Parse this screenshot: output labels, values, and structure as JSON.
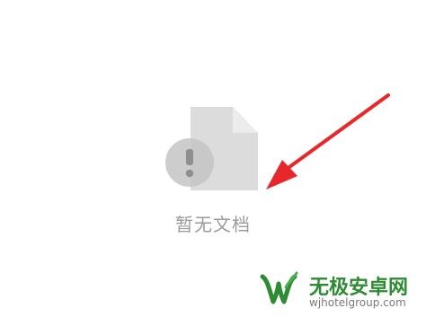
{
  "empty_state": {
    "message": "暂无文档",
    "illustration_icon": "document-warning-icon"
  },
  "annotation": {
    "icon": "red-arrow-icon",
    "color": "#e8272b"
  },
  "watermark": {
    "title": "无极安卓网",
    "url": "wjhotelgroup.com",
    "logo_icon": "w-leaf-logo-icon",
    "brand_color": "#2e8b34"
  },
  "colors": {
    "background": "#ffffff",
    "icon_gray": "#d8d8d8",
    "icon_fold": "#e6e6e6",
    "text_gray": "#9b9b9b"
  }
}
